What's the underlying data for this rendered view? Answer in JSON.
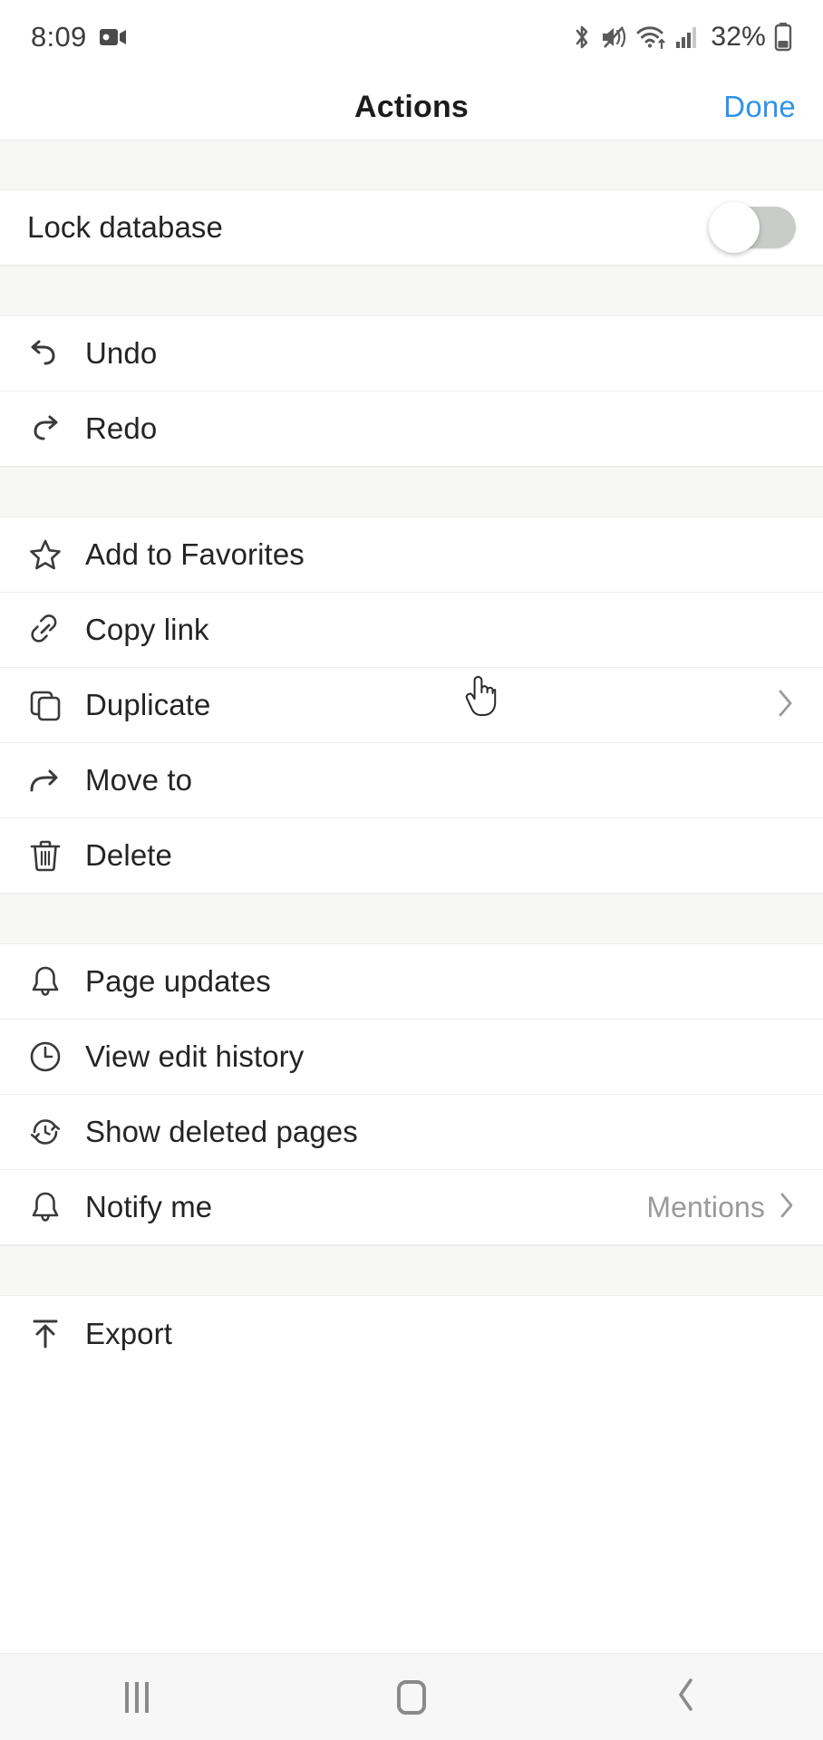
{
  "status_bar": {
    "time": "8:09",
    "battery_percent": "32%",
    "icons": [
      "screen-record-icon",
      "bluetooth-icon",
      "mute-icon",
      "wifi-icon",
      "signal-icon",
      "battery-icon"
    ]
  },
  "title_bar": {
    "title": "Actions",
    "done_label": "Done",
    "done_color": "#2f93e8"
  },
  "sections": [
    {
      "id": "lock",
      "rows": [
        {
          "label": "Lock database",
          "icon": "",
          "control": "toggle",
          "toggle_on": false
        }
      ]
    },
    {
      "id": "history",
      "rows": [
        {
          "label": "Undo",
          "icon": "undo-icon",
          "control": "none"
        },
        {
          "label": "Redo",
          "icon": "redo-icon",
          "control": "none"
        }
      ]
    },
    {
      "id": "page-actions",
      "rows": [
        {
          "label": "Add to Favorites",
          "icon": "star-icon",
          "control": "none"
        },
        {
          "label": "Copy link",
          "icon": "link-icon",
          "control": "none"
        },
        {
          "label": "Duplicate",
          "icon": "duplicate-icon",
          "control": "chevron",
          "cursor": true
        },
        {
          "label": "Move to",
          "icon": "move-to-icon",
          "control": "none"
        },
        {
          "label": "Delete",
          "icon": "trash-icon",
          "control": "none"
        }
      ]
    },
    {
      "id": "updates",
      "rows": [
        {
          "label": "Page updates",
          "icon": "bell-icon",
          "control": "none"
        },
        {
          "label": "View edit history",
          "icon": "clock-icon",
          "control": "none"
        },
        {
          "label": "Show deleted pages",
          "icon": "restore-icon",
          "control": "none"
        },
        {
          "label": "Notify me",
          "icon": "bell-icon",
          "control": "value-chevron",
          "value": "Mentions"
        }
      ]
    },
    {
      "id": "export",
      "rows": [
        {
          "label": "Export",
          "icon": "export-icon",
          "control": "none"
        }
      ]
    }
  ],
  "nav_bar": {
    "recents_label": "recents-icon",
    "home_label": "home-icon",
    "back_label": "back-icon"
  }
}
